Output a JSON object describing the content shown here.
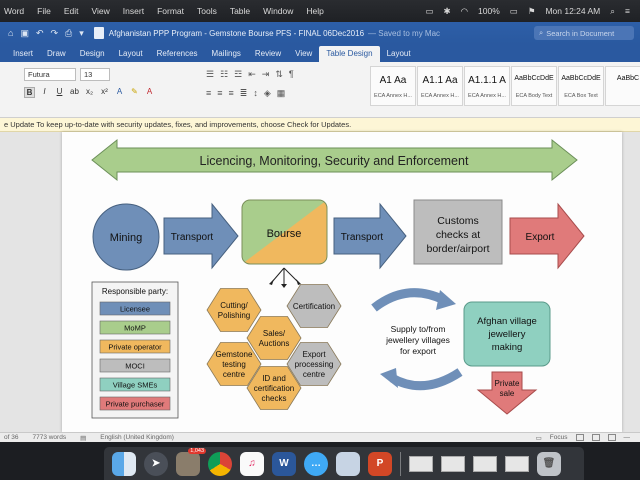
{
  "menubar": {
    "items": [
      "Word",
      "File",
      "Edit",
      "View",
      "Insert",
      "Format",
      "Tools",
      "Table",
      "Window",
      "Help"
    ],
    "battery": "100%",
    "clock": "Mon 12:24 AM"
  },
  "titlebar": {
    "title": "Afghanistan PPP Program - Gemstone Bourse PFS - FINAL 06Dec2016",
    "saved": "— Saved to my Mac",
    "search_placeholder": "Search in Document"
  },
  "tabs": [
    "Insert",
    "Draw",
    "Design",
    "Layout",
    "References",
    "Mailings",
    "Review",
    "View",
    "Table Design",
    "Layout"
  ],
  "active_tab_index": 8,
  "ribbon": {
    "font": "Futura",
    "size": "13",
    "styles": [
      {
        "sample": "A1 Aa",
        "name": "ECA Annex H..."
      },
      {
        "sample": "A1.1 Aa",
        "name": "ECA Annex H..."
      },
      {
        "sample": "A1.1.1 A",
        "name": "ECA Annex H..."
      },
      {
        "sample": "AaBbCcDdE",
        "name": "ECA Body Text"
      },
      {
        "sample": "AaBbCcDdE",
        "name": "ECA Box Text"
      },
      {
        "sample": "AaBbC",
        "name": ""
      }
    ]
  },
  "infobar": {
    "prefix": "e Update",
    "message": "To keep up-to-date with security updates, fixes, and improvements, choose Check for Updates."
  },
  "diagram": {
    "banner": "Licencing, Monitoring, Security and Enforcement",
    "mining": "Mining",
    "transport1": "Transport",
    "bourse": "Bourse",
    "transport2": "Transport",
    "customs": [
      "Customs",
      "checks at",
      "border/airport"
    ],
    "export": "Export",
    "legend_title": "Responsible party:",
    "legend": [
      {
        "label": "Licensee",
        "color": "#6f8fb8"
      },
      {
        "label": "MoMP",
        "color": "#a9cd8c"
      },
      {
        "label": "Private operator",
        "color": "#f0b85e"
      },
      {
        "label": "MOCI",
        "color": "#bdbdbd"
      },
      {
        "label": "Village SMEs",
        "color": "#8fd0c0"
      },
      {
        "label": "Private purchaser",
        "color": "#e07a7a"
      }
    ],
    "hexes": [
      {
        "lines": [
          "Cutting/",
          "Polishing"
        ],
        "color": "#f0b85e"
      },
      {
        "lines": [
          "Certification"
        ],
        "color": "#bdbdbd"
      },
      {
        "lines": [
          "Sales/",
          "Auctions"
        ],
        "color": "#f0b85e"
      },
      {
        "lines": [
          "Gemstone",
          "testing",
          "centre"
        ],
        "color": "#f0b85e"
      },
      {
        "lines": [
          "Export",
          "processing",
          "centre"
        ],
        "color": "#bdbdbd"
      },
      {
        "lines": [
          "ID and",
          "certification",
          "checks"
        ],
        "color": "#f0b85e"
      }
    ],
    "supply": [
      "Supply to/from",
      "jewellery villages",
      "for export"
    ],
    "village": [
      "Afghan village",
      "jewellery",
      "making"
    ],
    "private_sale": [
      "Private",
      "sale"
    ]
  },
  "status": {
    "page": "of 36",
    "words": "7773 words",
    "language": "English (United Kingdom)",
    "focus": "Focus"
  },
  "dock": {
    "badge": "1,043"
  }
}
